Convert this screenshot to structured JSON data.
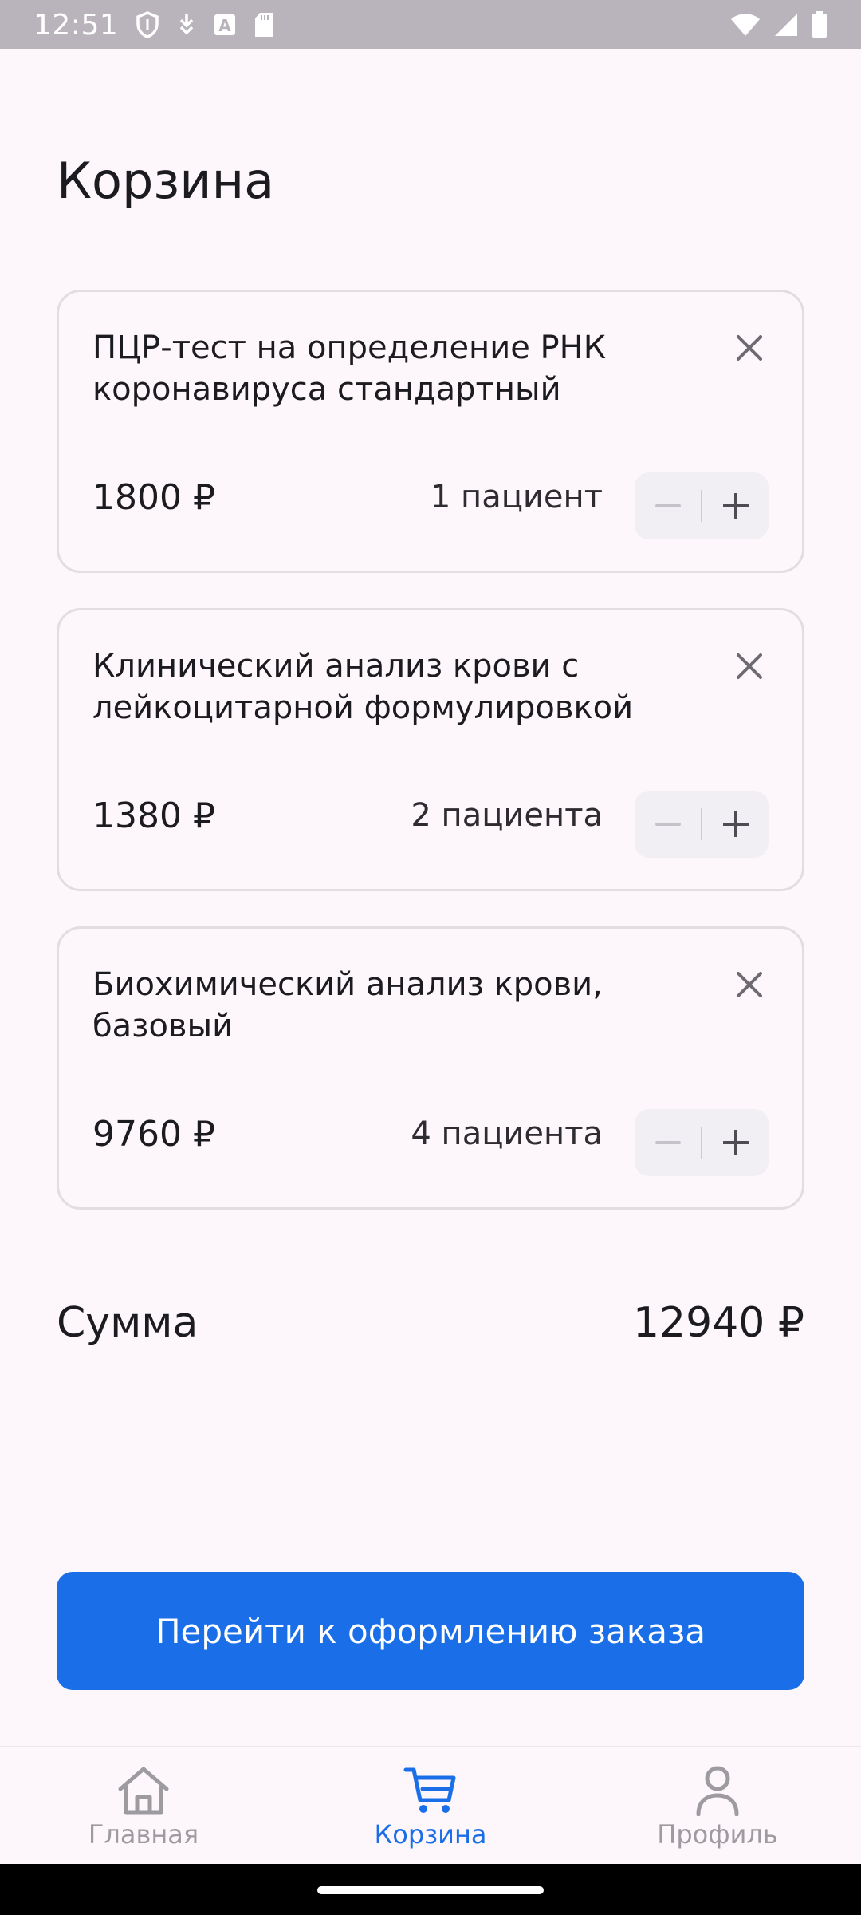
{
  "status_bar": {
    "time": "12:51",
    "left_icons": [
      "shield-icon",
      "download-arrow-icon",
      "a-font-icon",
      "sd-card-icon"
    ],
    "right_icons": [
      "wifi-icon",
      "cell-signal-icon",
      "battery-icon"
    ]
  },
  "page": {
    "title": "Корзина"
  },
  "cart": {
    "items": [
      {
        "title": "ПЦР-тест на определение РНК коронавируса стандартный",
        "price": "1800 ₽",
        "patients": "1 пациент"
      },
      {
        "title": "Клинический анализ крови с лейкоцитарной формулировкой",
        "price": "1380 ₽",
        "patients": "2 пациента"
      },
      {
        "title": "Биохимический анализ крови, базовый",
        "price": "9760 ₽",
        "patients": "4 пациента"
      }
    ],
    "sum_label": "Сумма",
    "sum_value": "12940 ₽"
  },
  "checkout_button": {
    "label": "Перейти к оформлению заказа"
  },
  "bottom_nav": {
    "items": [
      {
        "label": "Главная",
        "icon": "home-icon",
        "active": false
      },
      {
        "label": "Корзина",
        "icon": "cart-icon",
        "active": true
      },
      {
        "label": "Профиль",
        "icon": "profile-icon",
        "active": false
      }
    ]
  },
  "colors": {
    "accent": "#1a6fe8",
    "background": "#fdf7fc",
    "card_border": "#e2dde2",
    "nav_inactive": "#9d9aa0"
  }
}
